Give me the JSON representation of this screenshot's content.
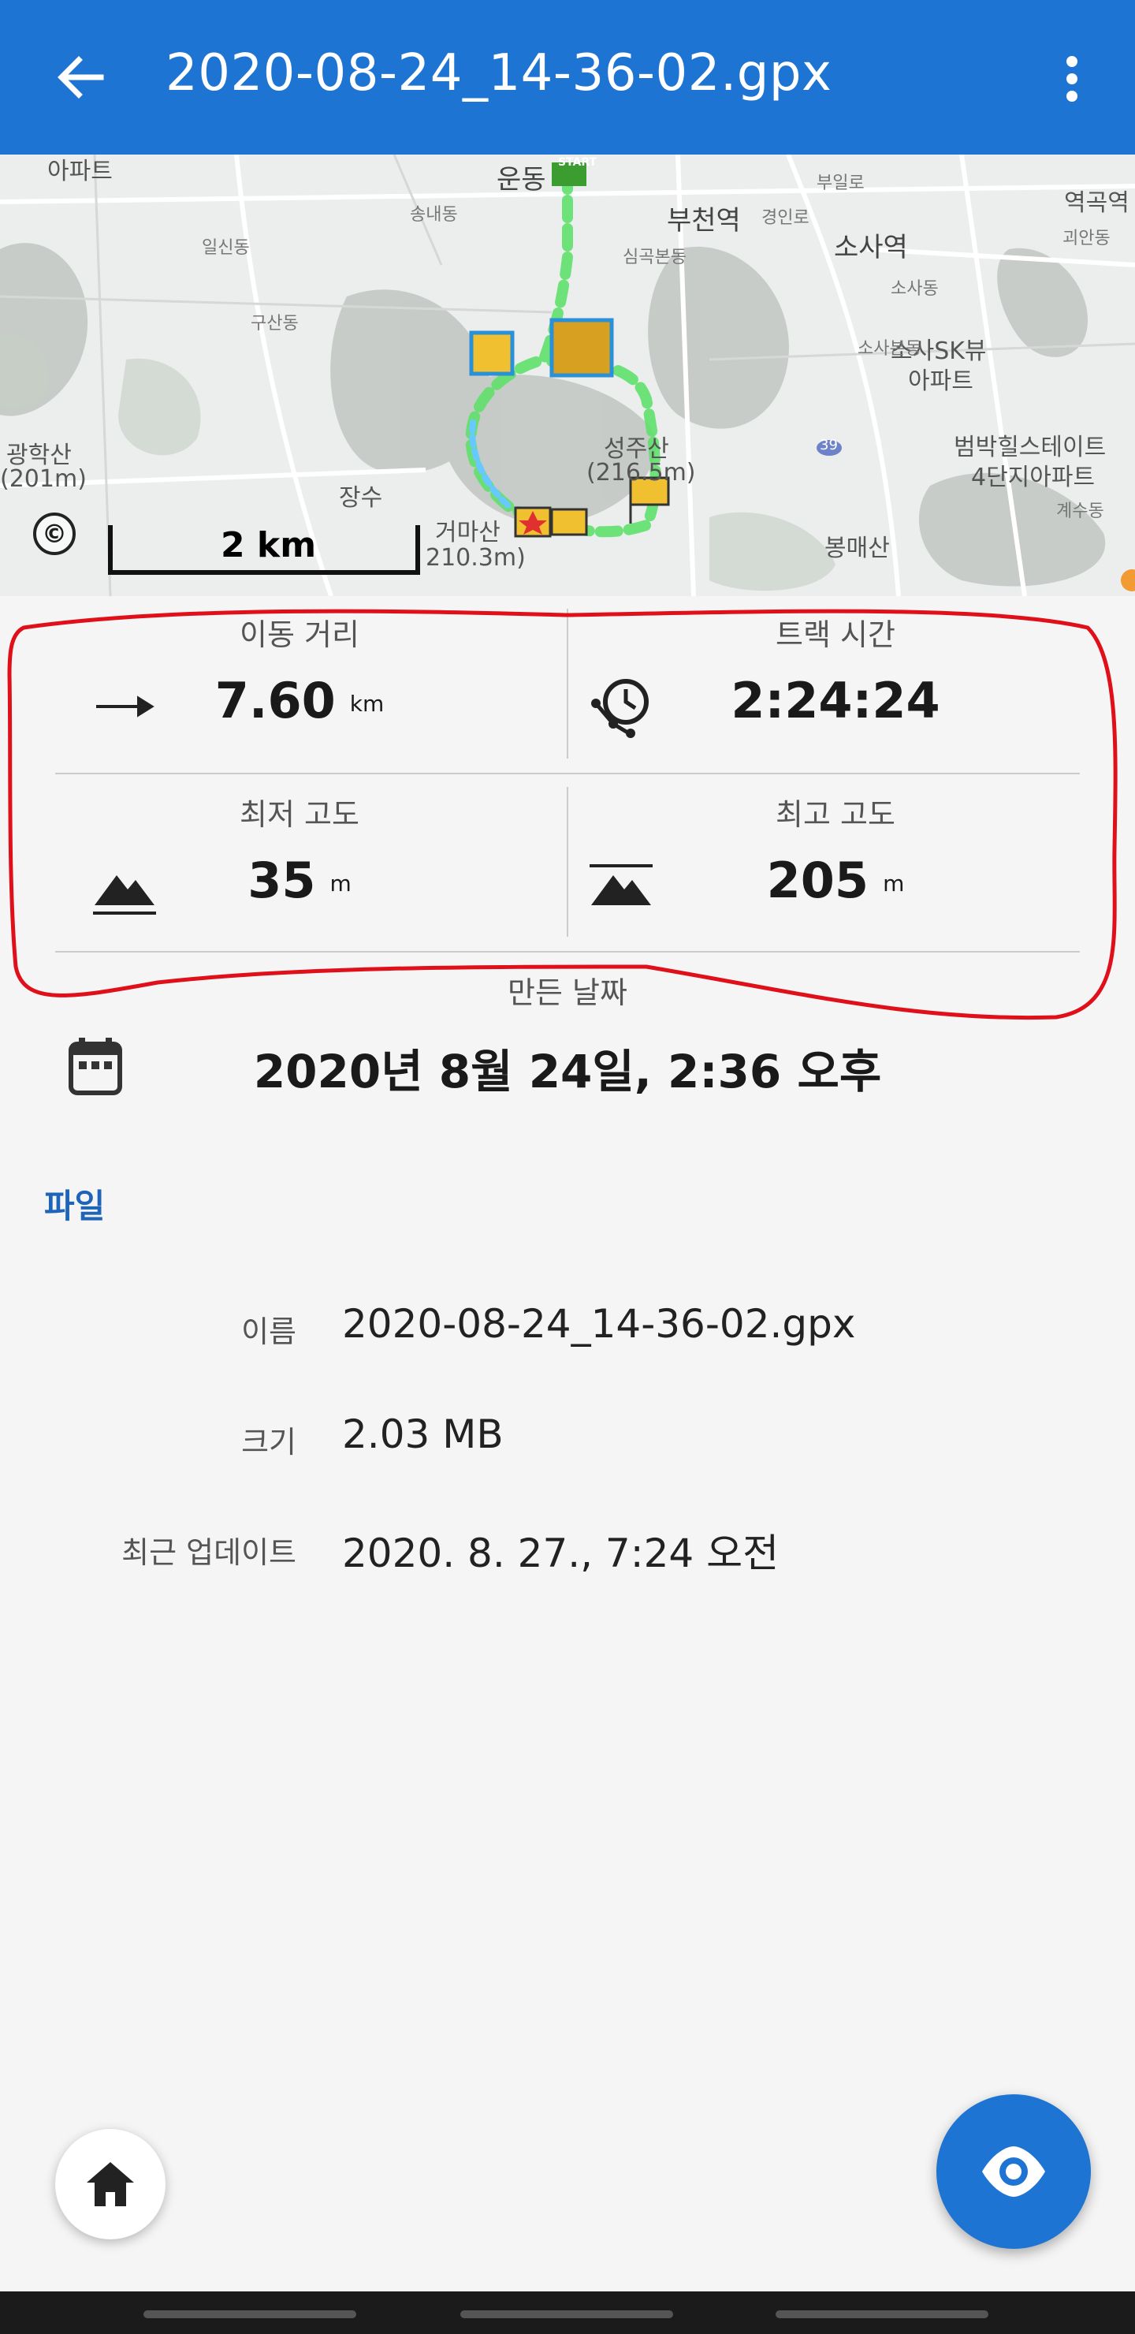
{
  "appbar": {
    "title": "2020-08-24_14-36-02.gpx",
    "back_icon": "arrow-back-icon",
    "more_icon": "more-vert-icon"
  },
  "map": {
    "scale": "2 km",
    "copyright_symbol": "©",
    "labels": {
      "apartment": "아파트",
      "yungdong": "운동",
      "bucheon_station": "부천역",
      "yeokgok_station": "역곡역",
      "sosa_station": "소사역",
      "sosa_sk": "소사SK뷰",
      "sosa_sk_apt": "아파트",
      "gwanghaksan": "광학산",
      "gwanghaksan_h": "(201m)",
      "seongjusan": "성주산",
      "seongjusan_h": "(216.5m)",
      "geomasan": "거마산",
      "geomasan_h": "210.3m)",
      "bongmaesan": "봉매산",
      "beombak": "범박힐스테이트",
      "beombak2": "4단지아파트",
      "jangsu": "장수",
      "songnaedong": "송내동",
      "ilsindong": "일신동",
      "gusandong": "구산동",
      "simgokbondong": "심곡본동",
      "gyeongin": "경인로",
      "bueol": "부일로",
      "goeandong": "괴안동",
      "sosadong": "소사동",
      "sosabondong": "소사본동",
      "gyesudong": "계수동",
      "start": "START",
      "route_39": "39"
    }
  },
  "stats": {
    "distance": {
      "label": "이동 거리",
      "value": "7.60",
      "unit": "km",
      "icon": "arrow-right-icon"
    },
    "track_time": {
      "label": "트랙 시간",
      "value": "2:24:24",
      "icon": "route-clock-icon"
    },
    "min_elevation": {
      "label": "최저 고도",
      "value": "35",
      "unit": "m",
      "icon": "mountain-low-icon"
    },
    "max_elevation": {
      "label": "최고 고도",
      "value": "205",
      "unit": "m",
      "icon": "mountain-high-icon"
    }
  },
  "created": {
    "label": "만든 날짜",
    "value": "2020년 8월 24일, 2:36 오후",
    "icon": "calendar-icon"
  },
  "file": {
    "section_title": "파일",
    "rows": [
      {
        "key": "이름",
        "value": "2020-08-24_14-36-02.gpx"
      },
      {
        "key": "크기",
        "value": "2.03 MB"
      },
      {
        "key": "최근 업데이트",
        "value": "2020. 8. 27., 7:24 오전"
      }
    ]
  },
  "actions": {
    "home_icon": "home-icon",
    "view_icon": "eye-icon"
  },
  "colors": {
    "primary": "#1e74d2",
    "route": "#6ee07a",
    "annotation": "#e0101a"
  }
}
